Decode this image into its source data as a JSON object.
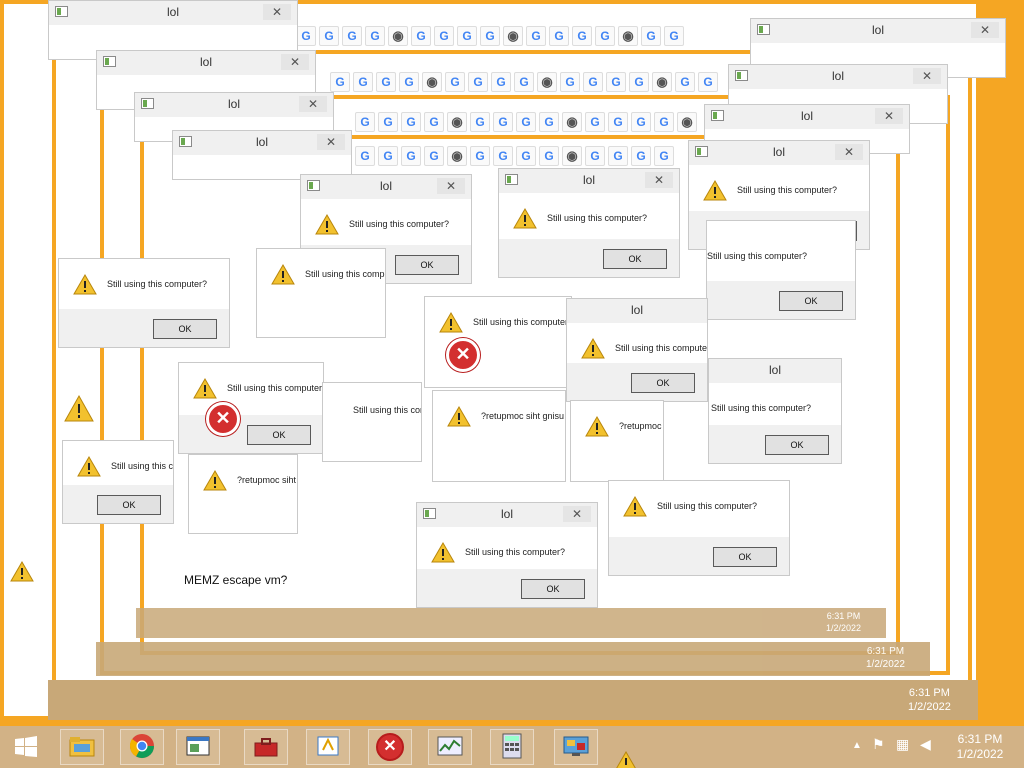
{
  "dialog": {
    "title": "lol",
    "message": "Still using this computer?",
    "reversed_message": "?retupmoc siht gnisu llitS",
    "ok_label": "OK"
  },
  "taskbar": {
    "time": "6:31 PM",
    "date": "1/2/2022"
  },
  "memz_label": "MEMZ escape vm?",
  "icons": {
    "start": "windows-logo-icon",
    "explorer": "file-explorer-icon",
    "chrome": "chrome-icon",
    "notepad": "window-app-icon",
    "toolbox": "toolbox-icon",
    "paint": "paint-icon",
    "error": "error-icon",
    "taskmgr": "task-manager-icon",
    "calculator": "calculator-icon",
    "control": "control-panel-icon"
  },
  "colors": {
    "accent": "#f5a623",
    "error": "#d32f2f",
    "warning": "#f2c12e"
  }
}
